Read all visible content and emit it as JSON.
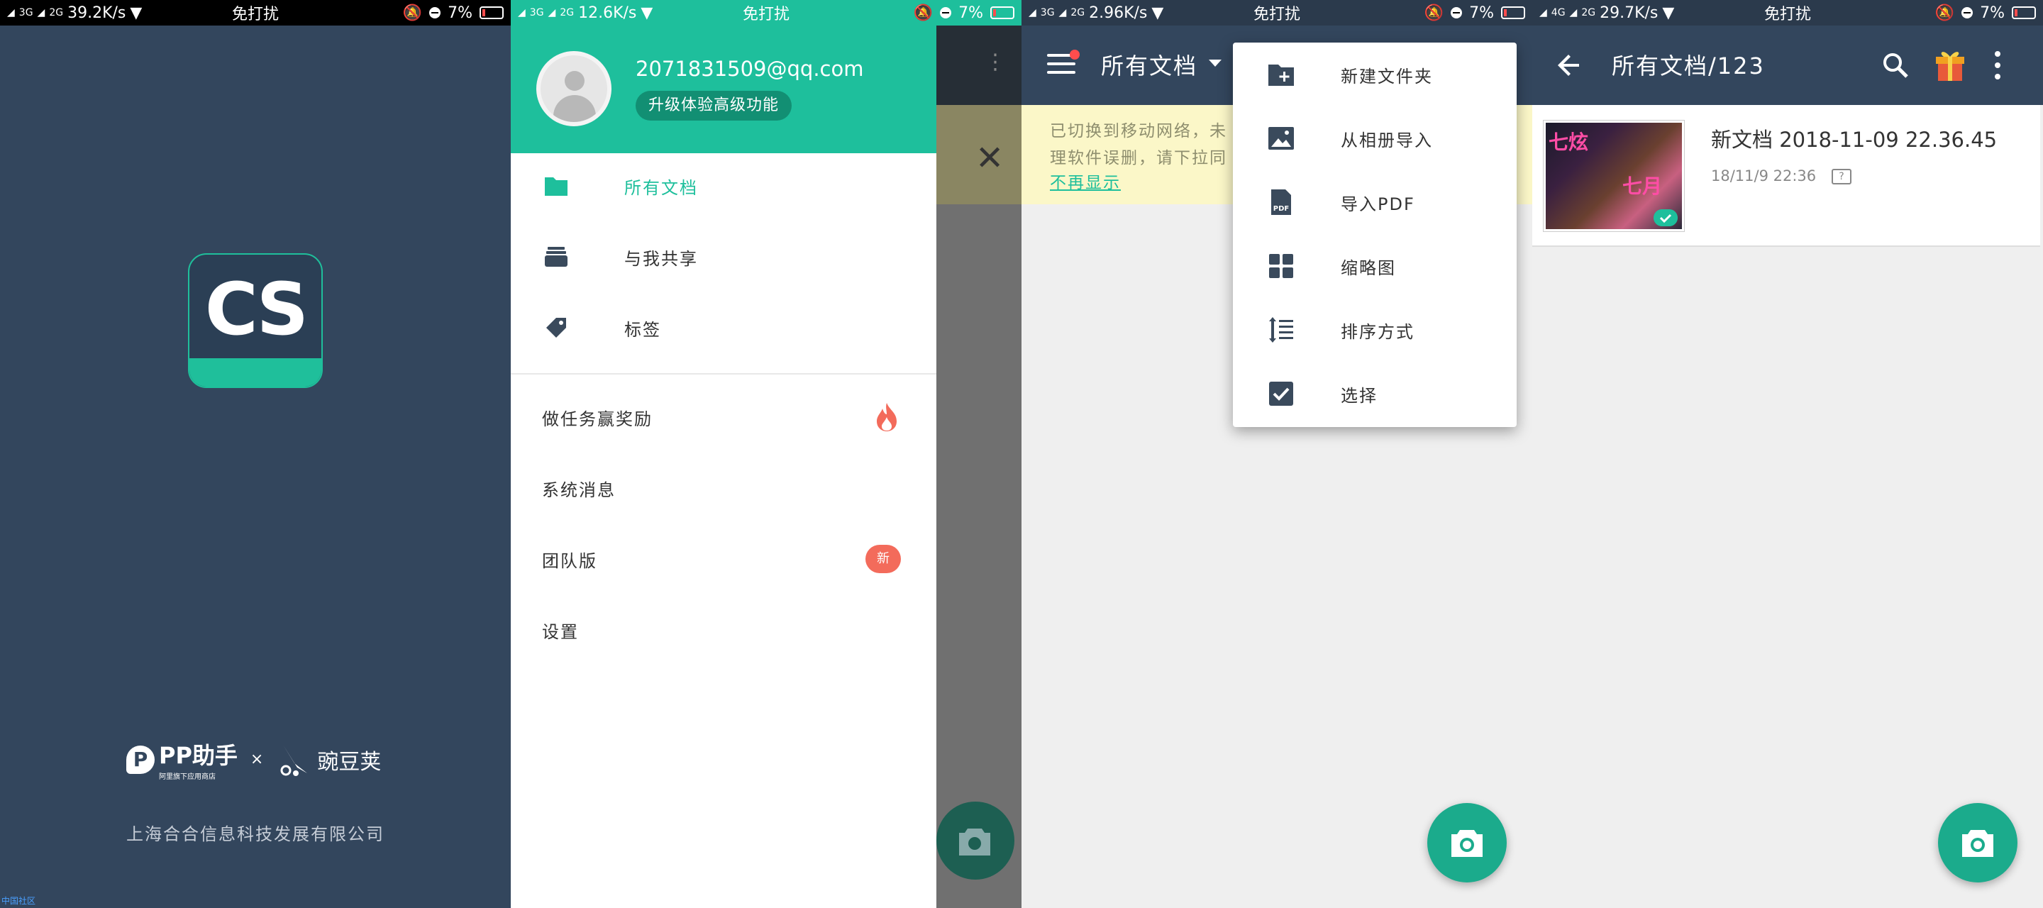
{
  "status_bars": [
    {
      "speed": "39.2K/s",
      "mode": "免打扰",
      "battery": "7%",
      "net1": "3G",
      "net2": "2G"
    },
    {
      "speed": "12.6K/s",
      "mode": "免打扰",
      "battery": "7%",
      "net1": "3G",
      "net2": "2G"
    },
    {
      "speed": "2.96K/s",
      "mode": "免打扰",
      "battery": "7%",
      "net1": "3G",
      "net2": "2G"
    },
    {
      "speed": "29.7K/s",
      "mode": "免打扰",
      "battery": "7%",
      "net1": "4G",
      "net2": "2G"
    }
  ],
  "splash": {
    "logo_text": "CS",
    "partner_pp": "PP助手",
    "partner_pp_sub": "阿里旗下应用商店",
    "times": "×",
    "partner_wdj": "豌豆荚",
    "company": "上海合合信息科技发展有限公司",
    "corner": "中国社区"
  },
  "drawer": {
    "email": "2071831509@qq.com",
    "upgrade": "升级体验高级功能",
    "nav": [
      {
        "label": "所有文档",
        "icon": "folder-icon",
        "active": true
      },
      {
        "label": "与我共享",
        "icon": "shared-stack-icon",
        "active": false
      },
      {
        "label": "标签",
        "icon": "tag-icon",
        "active": false
      }
    ],
    "menu": [
      {
        "label": "做任务赢奖励",
        "extra": "fire-icon"
      },
      {
        "label": "系统消息"
      },
      {
        "label": "团队版",
        "badge": "新"
      },
      {
        "label": "设置"
      }
    ]
  },
  "docs_view": {
    "title": "所有文档",
    "notice": {
      "line1": "已切换到移动网络，未",
      "line2": "理软件误删，请下拉同",
      "link": "不再显示"
    },
    "popup_menu": [
      {
        "label": "新建文件夹",
        "icon": "new-folder-icon"
      },
      {
        "label": "从相册导入",
        "icon": "image-icon"
      },
      {
        "label": "导入PDF",
        "icon": "pdf-icon"
      },
      {
        "label": "缩略图",
        "icon": "grid-icon"
      },
      {
        "label": "排序方式",
        "icon": "sort-icon"
      },
      {
        "label": "选择",
        "icon": "checkbox-icon"
      }
    ]
  },
  "folder_view": {
    "title": "所有文档/123",
    "doc": {
      "title": "新文档 2018-11-09 22.36.45",
      "date": "18/11/9 22:36",
      "page_badge": "?",
      "thumb_text1": "七炫",
      "thumb_text2": "七月"
    }
  },
  "colors": {
    "primary": "#33465d",
    "accent": "#1ebf9c",
    "badge": "#f36b5b",
    "notice_bg": "#fbf7c8"
  }
}
